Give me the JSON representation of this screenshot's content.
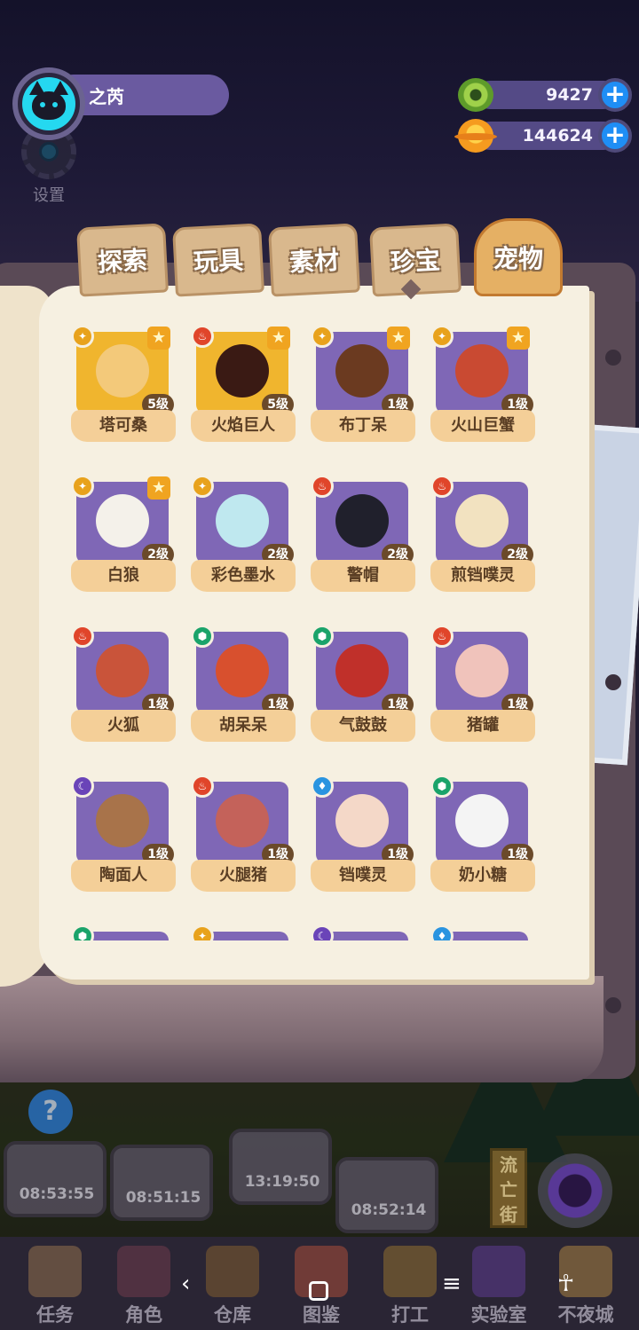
{
  "profile": {
    "name": "之芮"
  },
  "settings": {
    "label": "设置"
  },
  "currency": [
    {
      "icon": "green-coin-icon",
      "value": "9427"
    },
    {
      "icon": "orange-planet-icon",
      "value": "144624"
    }
  ],
  "tabs": [
    {
      "label": "探索",
      "active": false
    },
    {
      "label": "玩具",
      "active": false
    },
    {
      "label": "素材",
      "active": false
    },
    {
      "label": "珍宝",
      "active": false
    },
    {
      "label": "宠物",
      "active": true
    }
  ],
  "pets": [
    {
      "name": "塔可桑",
      "level": "5级",
      "element": "yellow",
      "starred": true,
      "rare": true
    },
    {
      "name": "火焰巨人",
      "level": "5级",
      "element": "red",
      "starred": true,
      "rare": true
    },
    {
      "name": "布丁呆",
      "level": "1级",
      "element": "yellow",
      "starred": true,
      "rare": false
    },
    {
      "name": "火山巨蟹",
      "level": "1级",
      "element": "yellow",
      "starred": true,
      "rare": false
    },
    {
      "name": "白狼",
      "level": "2级",
      "element": "yellow",
      "starred": true,
      "rare": false
    },
    {
      "name": "彩色墨水",
      "level": "2级",
      "element": "yellow",
      "starred": false,
      "rare": false
    },
    {
      "name": "警帽",
      "level": "2级",
      "element": "red",
      "starred": false,
      "rare": false
    },
    {
      "name": "煎铛噗灵",
      "level": "2级",
      "element": "red",
      "starred": false,
      "rare": false
    },
    {
      "name": "火狐",
      "level": "1级",
      "element": "red",
      "starred": false,
      "rare": false
    },
    {
      "name": "胡呆呆",
      "level": "1级",
      "element": "green",
      "starred": false,
      "rare": false
    },
    {
      "name": "气鼓鼓",
      "level": "1级",
      "element": "green",
      "starred": false,
      "rare": false
    },
    {
      "name": "猪罐",
      "level": "1级",
      "element": "red",
      "starred": false,
      "rare": false
    },
    {
      "name": "陶面人",
      "level": "1级",
      "element": "purple",
      "starred": false,
      "rare": false
    },
    {
      "name": "火腿猪",
      "level": "1级",
      "element": "red",
      "starred": false,
      "rare": false
    },
    {
      "name": "铛噗灵",
      "level": "1级",
      "element": "blue",
      "starred": false,
      "rare": false
    },
    {
      "name": "奶小糖",
      "level": "1级",
      "element": "green",
      "starred": false,
      "rare": false
    },
    {
      "name": "",
      "level": "",
      "element": "green",
      "starred": false,
      "rare": false
    },
    {
      "name": "",
      "level": "",
      "element": "yellow",
      "starred": false,
      "rare": false
    },
    {
      "name": "",
      "level": "",
      "element": "purple",
      "starred": false,
      "rare": false
    },
    {
      "name": "",
      "level": "",
      "element": "blue",
      "starred": false,
      "rare": false
    }
  ],
  "timers": [
    "08:53:55",
    "08:51:15",
    "13:19:50",
    "08:52:14"
  ],
  "street_sign": "流亡街",
  "nav": [
    "任务",
    "角色",
    "仓库",
    "图鉴",
    "打工",
    "实验室",
    "不夜城"
  ],
  "colors": {
    "element_yellow": "#e8a21c",
    "element_red": "#e0452a",
    "element_green": "#1aa36a",
    "element_purple": "#6a44b8",
    "element_blue": "#2a94e0",
    "card_purple": "#7f67b6",
    "card_gold": "#f0b52e",
    "sprite_colors": [
      "#f3c97a",
      "#3a1a14",
      "#6b3a20",
      "#c94a32",
      "#f4f1ea",
      "#bfe8ef",
      "#20202c",
      "#f2e2c0",
      "#c9543a",
      "#d8502e",
      "#c0302a",
      "#f0c3bb",
      "#a8734a",
      "#c4625a",
      "#f4d8c8",
      "#f4f4f4",
      "#7bb0e0",
      "#e0b060",
      "#6a60a0",
      "#d89060"
    ]
  }
}
